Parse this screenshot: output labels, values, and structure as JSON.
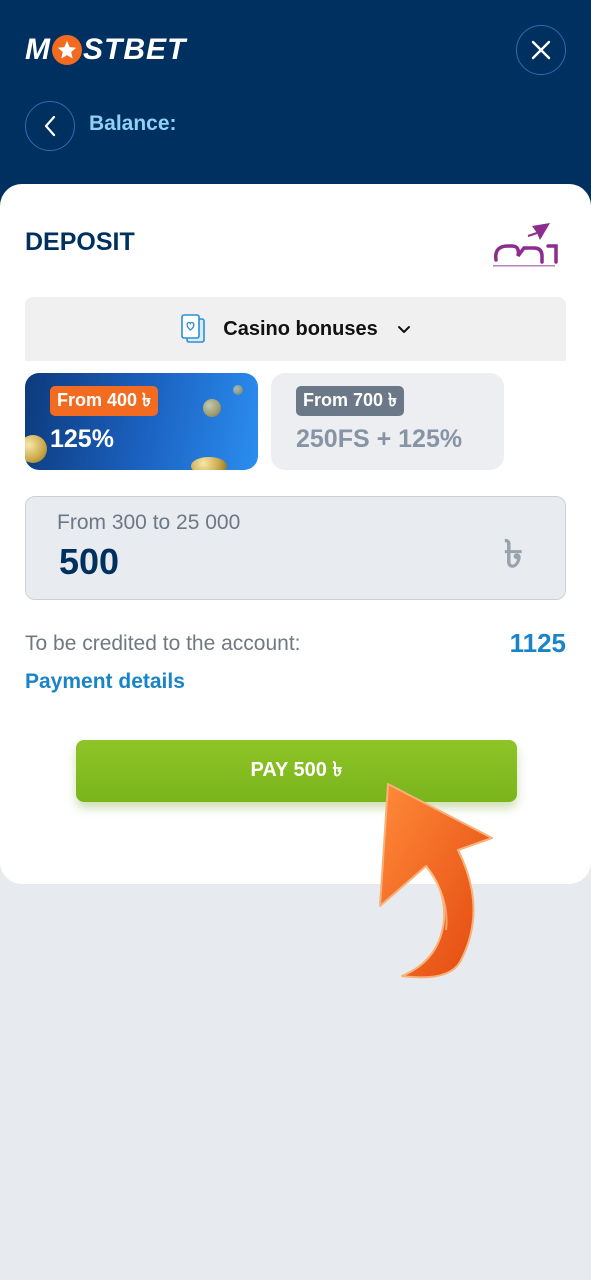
{
  "header": {
    "logo_text_left": "M",
    "logo_text_right": "STBET",
    "balance_label": "Balance:"
  },
  "deposit": {
    "title": "DEPOSIT",
    "payment_method_logo": "rocket-logo"
  },
  "bonus_select": {
    "label": "Casino bonuses"
  },
  "bonuses": [
    {
      "badge": "From 400 ৳",
      "value": "125%"
    },
    {
      "badge": "From 700 ৳",
      "value": "250FS + 125%"
    }
  ],
  "amount": {
    "range": "From 300 to 25 000",
    "value": "500",
    "currency_symbol": "৳"
  },
  "summary": {
    "credited_label": "To be credited to the account:",
    "credited_value": "1125",
    "payment_details": "Payment details"
  },
  "pay_button": {
    "label": "PAY 500 ৳"
  },
  "colors": {
    "header_bg": "#00305f",
    "accent_orange": "#f26b21",
    "accent_blue": "#1a84c8",
    "pay_green": "#8ec427",
    "page_bg": "#e7eaee"
  }
}
